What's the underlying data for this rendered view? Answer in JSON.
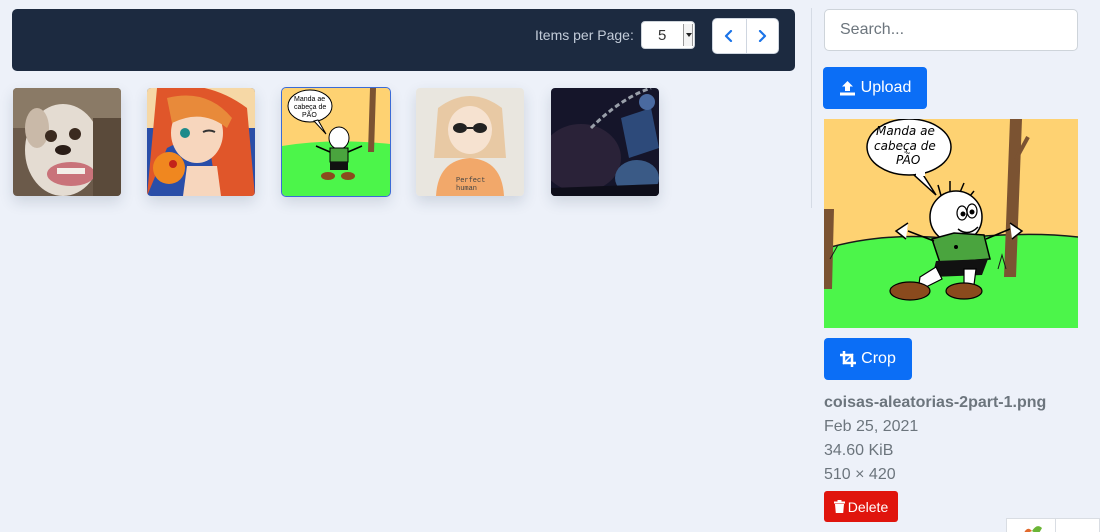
{
  "toolbar": {
    "items_per_page_label": "Items per Page:",
    "items_per_page_value": "5",
    "prev_icon": "chevron-left-icon",
    "next_icon": "chevron-right-icon"
  },
  "gallery": {
    "thumbnails": [
      {
        "subject": "dog photo"
      },
      {
        "subject": "anime girl holding orange ball"
      },
      {
        "subject": "cartoon boy comic",
        "selected": true
      },
      {
        "subject": "anime girl with sunglasses"
      },
      {
        "subject": "dark fantasy scene"
      }
    ]
  },
  "sidebar": {
    "search_placeholder": "Search...",
    "upload_label": "Upload",
    "upload_icon": "upload-icon",
    "crop_label": "Crop",
    "crop_icon": "crop-icon",
    "delete_label": "Delete",
    "delete_icon": "trash-icon",
    "preview_speech": [
      "Manda ae",
      "cabeça de",
      "PÃO"
    ]
  },
  "file_info": {
    "name": "coisas-aleatorias-2part-1.png",
    "date": "Feb 25, 2021",
    "size": "34.60 KiB",
    "dimensions": "510 × 420"
  },
  "colors": {
    "toolbar_bg": "#1c2a40",
    "accent": "#0b6ef6",
    "danger": "#e0150d",
    "page_bg": "#edf1f9"
  }
}
